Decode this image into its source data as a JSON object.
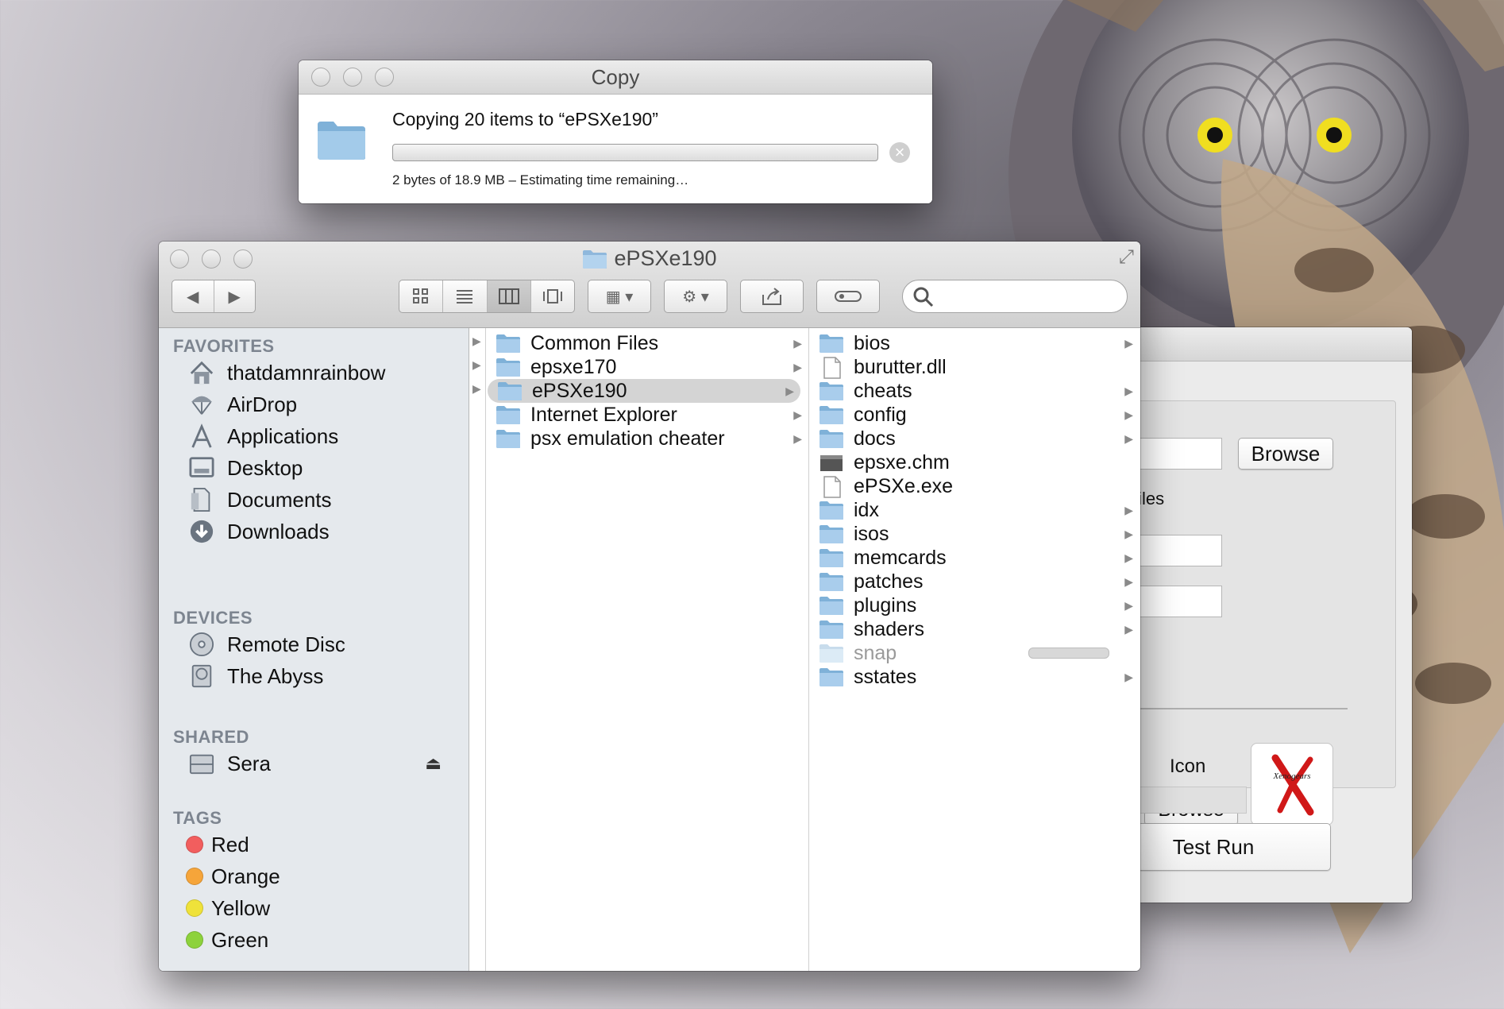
{
  "colors": {
    "accent": "#3d89e0",
    "folder": "#8fb8dc",
    "tag_red": "#f25e5e",
    "tag_orange": "#f6a53a",
    "tag_yellow": "#efe23a",
    "tag_green": "#8dd23c"
  },
  "copy_dialog": {
    "title": "Copy",
    "message": "Copying 20 items to “ePSXe190”",
    "status": "2 bytes of 18.9 MB – Estimating time remaining…",
    "progress": 0,
    "stop_icon": "stop-circle-icon"
  },
  "app_window": {
    "browse_top_label": "Browse",
    "files_label": "si files",
    "icon_label": "Icon",
    "browse_icon_label": "Browse",
    "test_run_label": "Test Run",
    "icon_logo_text": "Xenogears"
  },
  "finder": {
    "title": "ePSXe190",
    "toolbar": {
      "back_icon": "back-arrow-icon",
      "forward_icon": "forward-arrow-icon",
      "views": [
        "icon-view-icon",
        "list-view-icon",
        "column-view-icon",
        "coverflow-view-icon"
      ],
      "active_view": "column",
      "arrange_icon": "arrange-icon",
      "action_icon": "gear-icon",
      "share_icon": "share-icon",
      "tags_icon": "tag-oval-icon",
      "search_placeholder": ""
    },
    "sidebar": {
      "favorites_heading": "FAVORITES",
      "favorites": [
        {
          "label": "thatdamnrainbow",
          "icon": "home-icon"
        },
        {
          "label": "AirDrop",
          "icon": "airdrop-icon"
        },
        {
          "label": "Applications",
          "icon": "applications-icon"
        },
        {
          "label": "Desktop",
          "icon": "desktop-icon"
        },
        {
          "label": "Documents",
          "icon": "documents-icon"
        },
        {
          "label": "Downloads",
          "icon": "downloads-icon"
        }
      ],
      "devices_heading": "DEVICES",
      "devices": [
        {
          "label": "Remote Disc",
          "icon": "disc-icon"
        },
        {
          "label": "The Abyss",
          "icon": "hard-drive-icon"
        }
      ],
      "shared_heading": "SHARED",
      "shared": [
        {
          "label": "Sera",
          "icon": "server-icon"
        }
      ],
      "tags_heading": "TAGS",
      "tags": [
        {
          "label": "Red"
        },
        {
          "label": "Orange"
        },
        {
          "label": "Yellow"
        },
        {
          "label": "Green"
        }
      ]
    },
    "column1": [
      {
        "label": "Common Files"
      },
      {
        "label": "epsxe170"
      },
      {
        "label": "ePSXe190",
        "selected": true
      },
      {
        "label": "Internet Explorer"
      },
      {
        "label": "psx emulation cheater"
      }
    ],
    "column2": [
      {
        "label": "bios",
        "type": "folder"
      },
      {
        "label": "burutter.dll",
        "type": "file"
      },
      {
        "label": "cheats",
        "type": "folder"
      },
      {
        "label": "config",
        "type": "folder"
      },
      {
        "label": "docs",
        "type": "folder"
      },
      {
        "label": "epsxe.chm",
        "type": "chm"
      },
      {
        "label": "ePSXe.exe",
        "type": "file"
      },
      {
        "label": "idx",
        "type": "folder"
      },
      {
        "label": "isos",
        "type": "folder"
      },
      {
        "label": "memcards",
        "type": "folder"
      },
      {
        "label": "patches",
        "type": "folder"
      },
      {
        "label": "plugins",
        "type": "folder"
      },
      {
        "label": "shaders",
        "type": "folder"
      },
      {
        "label": "snap",
        "type": "folder",
        "copying": true
      },
      {
        "label": "sstates",
        "type": "folder"
      }
    ]
  }
}
